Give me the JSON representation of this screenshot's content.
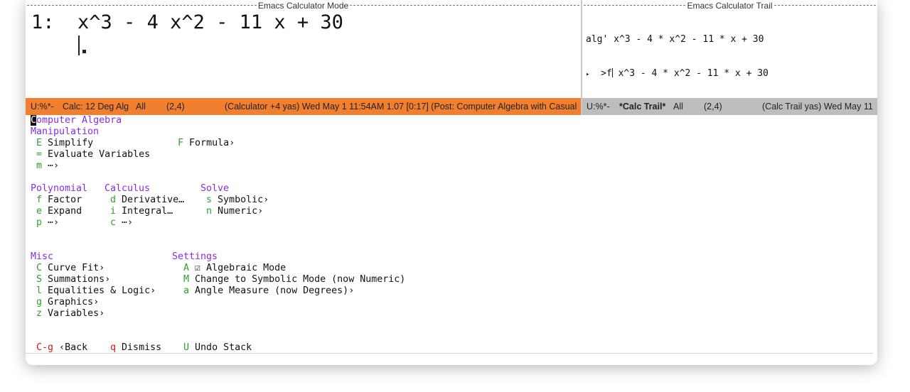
{
  "calc": {
    "header_title": "Emacs Calculator Mode",
    "stack_index": "1:",
    "stack_entry": "x^3 - 4 x^2 - 11 x + 30"
  },
  "trail": {
    "header_title": "Emacs Calculator Trail",
    "line1_tag": "alg'",
    "line1_expr": "x^3 - 4 * x^2 - 11 * x + 30",
    "line2_arrow": "▸",
    "line2_tag": ">f",
    "line2_expr": "x^3 - 4 * x^2 - 11 * x + 30"
  },
  "modeline_calc": {
    "status": "U:%*-",
    "buffer": "Calc: 12 Deg Alg",
    "scope": "All",
    "position": "(2,4)",
    "info": "(Calculator +4 yas) Wed May  1 11:54AM 1.07 [0:17] (Post: Computer Algebra with Casual"
  },
  "modeline_trail": {
    "status": "U:%*-",
    "buffer": "*Calc Trail*",
    "scope": "All",
    "position": "(2,4)",
    "info": "(Calc Trail yas) Wed May  11"
  },
  "menu": {
    "title_first": "C",
    "title_rest": "omputer Algebra",
    "manipulation": {
      "heading": "Manipulation",
      "items": [
        {
          "key": "E",
          "label": "Simplify"
        },
        {
          "key": "=",
          "label": "Evaluate Variables"
        },
        {
          "key": "m",
          "label": "⋯›"
        }
      ],
      "formula": {
        "key": "F",
        "label": "Formula›"
      }
    },
    "polynomial": {
      "heading": "Polynomial",
      "items": [
        {
          "key": "f",
          "label": "Factor"
        },
        {
          "key": "e",
          "label": "Expand"
        },
        {
          "key": "p",
          "label": "⋯›"
        }
      ]
    },
    "calculus": {
      "heading": "Calculus",
      "items": [
        {
          "key": "d",
          "label": "Derivative…"
        },
        {
          "key": "i",
          "label": "Integral…"
        },
        {
          "key": "c",
          "label": "⋯›"
        }
      ]
    },
    "solve": {
      "heading": "Solve",
      "items": [
        {
          "key": "s",
          "label": "Symbolic›"
        },
        {
          "key": "n",
          "label": "Numeric›"
        }
      ]
    },
    "misc": {
      "heading": "Misc",
      "items": [
        {
          "key": "C",
          "label": "Curve Fit›"
        },
        {
          "key": "S",
          "label": "Summations›"
        },
        {
          "key": "l",
          "label": "Equalities & Logic›"
        },
        {
          "key": "g",
          "label": "Graphics›"
        },
        {
          "key": "z",
          "label": "Variables›"
        }
      ]
    },
    "settings": {
      "heading": "Settings",
      "items": [
        {
          "key": "A",
          "label": "☑ Algebraic Mode"
        },
        {
          "key": "M",
          "label": "Change to Symbolic Mode (now Numeric)"
        },
        {
          "key": "a",
          "label": "Angle Measure (now Degrees)›"
        }
      ]
    },
    "footer": [
      {
        "key": "C-g",
        "label": "‹Back"
      },
      {
        "key": "q",
        "label": "Dismiss"
      },
      {
        "key": "U",
        "label": "Undo Stack"
      }
    ]
  },
  "colors": {
    "modeline_active": "#f08030",
    "modeline_inactive": "#bdbdbd",
    "heading": "#8a2be2",
    "key": "#2e9e2e",
    "key_transient": "#c41a1a"
  }
}
